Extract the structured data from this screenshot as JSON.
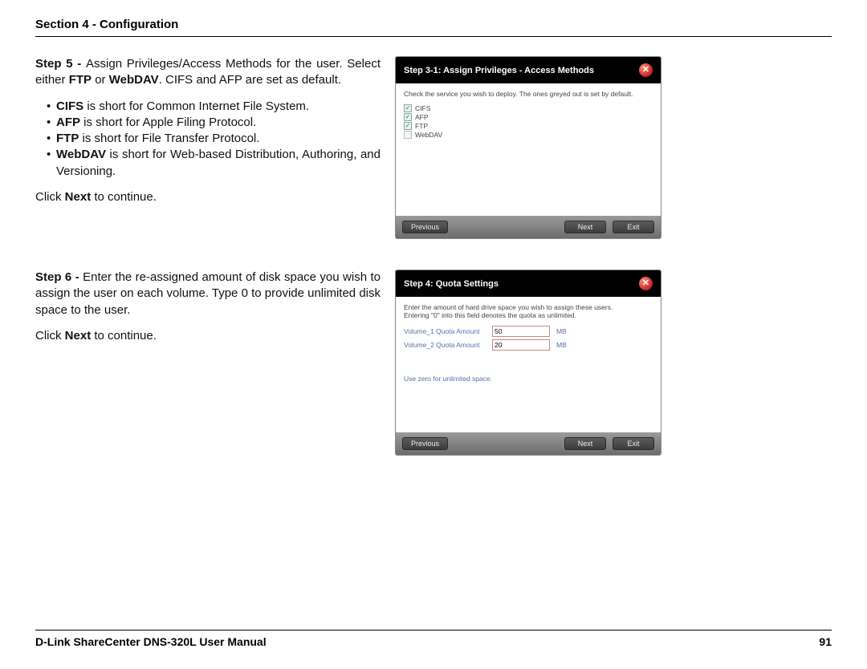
{
  "header": {
    "section": "Section 4 - Configuration"
  },
  "step5": {
    "lead_bold": "Step 5 - ",
    "lead_rest": "Assign Privileges/Access Methods for the user. Select either ",
    "lead_bold2": "FTP",
    "lead_mid": " or ",
    "lead_bold3": "WebDAV",
    "lead_tail": ". CIFS and AFP are set as default.",
    "bullets": {
      "cifs_b": "CIFS",
      "cifs_t": " is short for Common Internet File System.",
      "afp_b": "AFP",
      "afp_t": " is short for Apple Filing Protocol.",
      "ftp_b": "FTP",
      "ftp_t": " is short for File Transfer Protocol.",
      "web_b": "WebDAV",
      "web_t": " is short for Web-based Distribution, Authoring, and Versioning."
    },
    "click_pre": "Click ",
    "click_bold": "Next",
    "click_post": " to continue."
  },
  "step6": {
    "lead_bold": "Step 6 - ",
    "lead_rest": "Enter the re-assigned amount of disk space you wish to assign the user on each volume. Type 0 to provide unlimited disk space to the user.",
    "click_pre": "Click ",
    "click_bold": "Next",
    "click_post": " to continue."
  },
  "dlg1": {
    "title": "Step 3-1: Assign Privileges - Access Methods",
    "hint": "Check the service you wish to deploy. The ones greyed out is set by default.",
    "items": {
      "cifs": "CIFS",
      "afp": "AFP",
      "ftp": "FTP",
      "webdav": "WebDAV"
    },
    "buttons": {
      "prev": "Previous",
      "next": "Next",
      "exit": "Exit"
    },
    "close": "✕"
  },
  "dlg2": {
    "title": "Step 4: Quota Settings",
    "hint1": "Enter the amount of hard drive space you wish to assign these users.",
    "hint2": "Entering \"0\" into this field denotes the quota as unlimited.",
    "rows": {
      "v1_label": "Volume_1 Quota Amount",
      "v1_value": "50",
      "v1_unit": "MB",
      "v2_label": "Volume_2 Quota Amount",
      "v2_value": "20",
      "v2_unit": "MB"
    },
    "note": "Use zero for unlimited space.",
    "buttons": {
      "prev": "Previous",
      "next": "Next",
      "exit": "Exit"
    },
    "close": "✕"
  },
  "footer": {
    "left": "D-Link ShareCenter DNS-320L User Manual",
    "page": "91"
  }
}
